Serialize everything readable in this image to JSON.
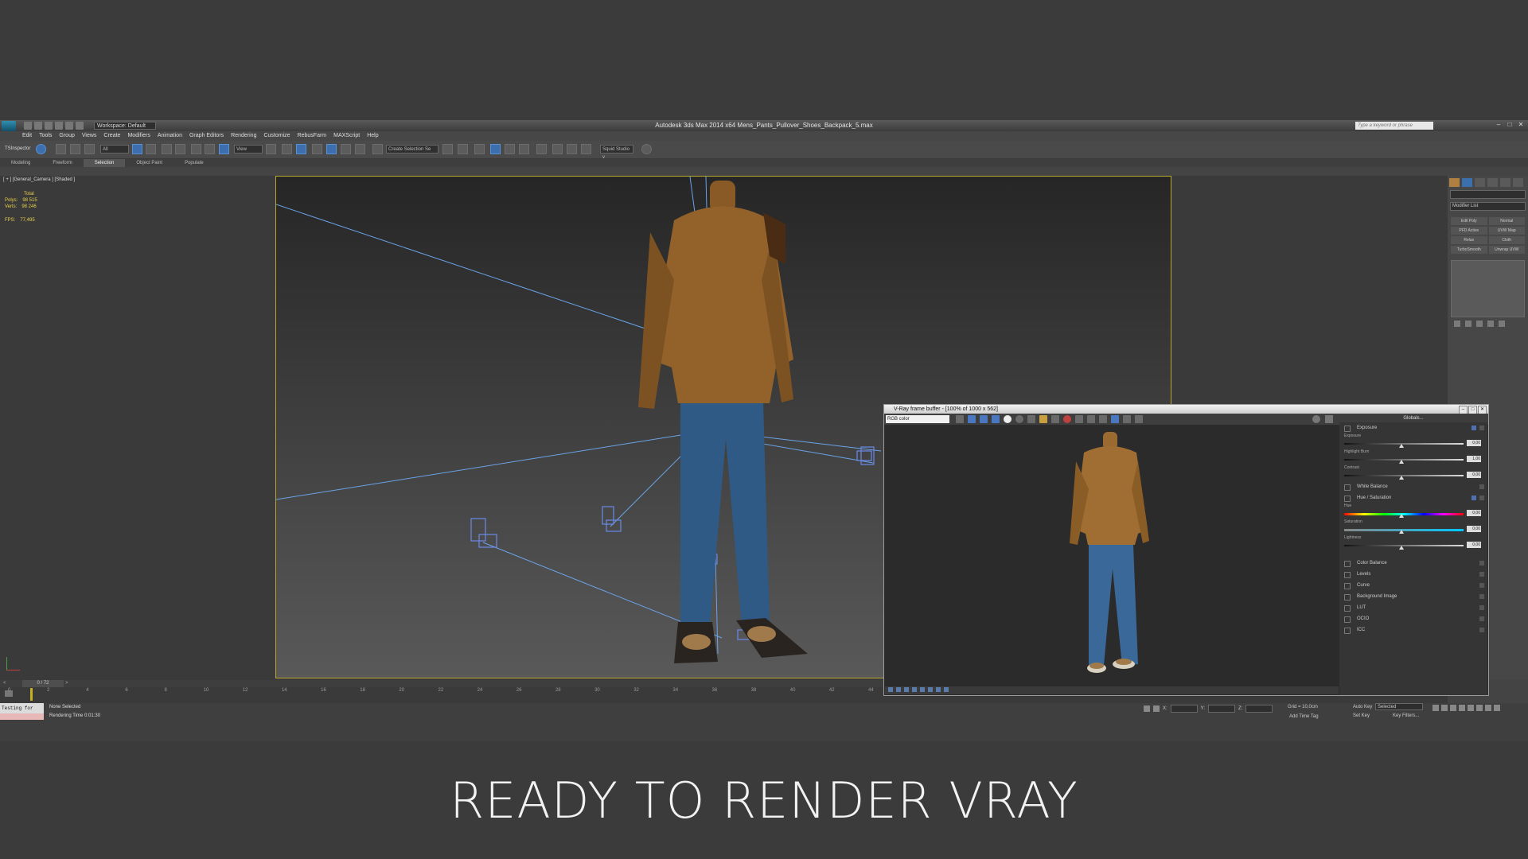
{
  "window": {
    "title": "Autodesk 3ds Max  2014 x64    Mens_Pants_Pullover_Shoes_Backpack_5.max",
    "workspace": "Workspace: Default",
    "search_placeholder": "Type a keyword or phrase"
  },
  "menu": [
    "Edit",
    "Tools",
    "Group",
    "Views",
    "Create",
    "Modifiers",
    "Animation",
    "Graph Editors",
    "Rendering",
    "Customize",
    "RebusFarm",
    "MAXScript",
    "Help"
  ],
  "toolbar": {
    "tsinspector": "TSInspector",
    "filter": "All",
    "ref_coord": "View",
    "selection_set": "Create Selection Se",
    "squid": "Squid Studio v"
  },
  "ribbon_tabs": [
    "Modeling",
    "Freeform",
    "Selection",
    "Object Paint",
    "Populate"
  ],
  "ribbon_active": "Selection",
  "viewport": {
    "label": "[ + ] [General_Camera ] [Shaded ]",
    "stats_total": "Total",
    "polys_label": "Polys:",
    "polys_value": "98 515",
    "verts_label": "Verts:",
    "verts_value": "98 246",
    "fps_label": "FPS:",
    "fps_value": "77,495"
  },
  "command_panel": {
    "modifier_list": "Modifier List",
    "modifiers": [
      "Edit Poly",
      "Normal",
      "PFD Active",
      "UVW Map",
      "Relax",
      "Cloth",
      "TurboSmooth",
      "Unwrap UVW"
    ]
  },
  "timeline": {
    "frame": "0 / 72",
    "ticks": [
      "0",
      "2",
      "4",
      "6",
      "8",
      "10",
      "12",
      "14",
      "16",
      "18",
      "20",
      "22",
      "24",
      "26",
      "28",
      "30",
      "32",
      "34",
      "36",
      "38",
      "40",
      "42",
      "44",
      "46",
      "48",
      "50",
      "52",
      "54",
      "56",
      "58",
      "60",
      "62",
      "64",
      "66",
      "68",
      "70",
      "72"
    ]
  },
  "status": {
    "listener": "Testing for",
    "prompt": "None Selected",
    "render_time": "Rendering Time  0:01:30",
    "x_label": "X:",
    "y_label": "Y:",
    "z_label": "Z:",
    "grid": "Grid = 10,0cm",
    "add_time_tag": "Add Time Tag",
    "auto_key": "Auto Key",
    "set_key": "Set Key",
    "selected": "Selected",
    "key_filters": "Key Filters..."
  },
  "vfb": {
    "title": "V-Ray frame buffer - [100% of 1000 x 562]",
    "channel": "RGB color",
    "globals": "Globals...",
    "exposure": "Exposure",
    "exposure_lbl": "Exposure",
    "exposure_val": "0,00",
    "highlight_lbl": "Highlight Burn",
    "highlight_val": "1,00",
    "contrast_lbl": "Contrast",
    "contrast_val": "0,00",
    "white_balance": "White Balance",
    "hue_sat": "Hue / Saturation",
    "hue_lbl": "Hue",
    "hue_val": "0,00",
    "sat_lbl": "Saturation",
    "sat_val": "0,00",
    "light_lbl": "Lightness",
    "light_val": "0,00",
    "corrections": [
      "Color Balance",
      "Levels",
      "Curve",
      "Background Image",
      "LUT",
      "OCIO",
      "ICC"
    ]
  },
  "headline": "READY TO RENDER  VRAY"
}
